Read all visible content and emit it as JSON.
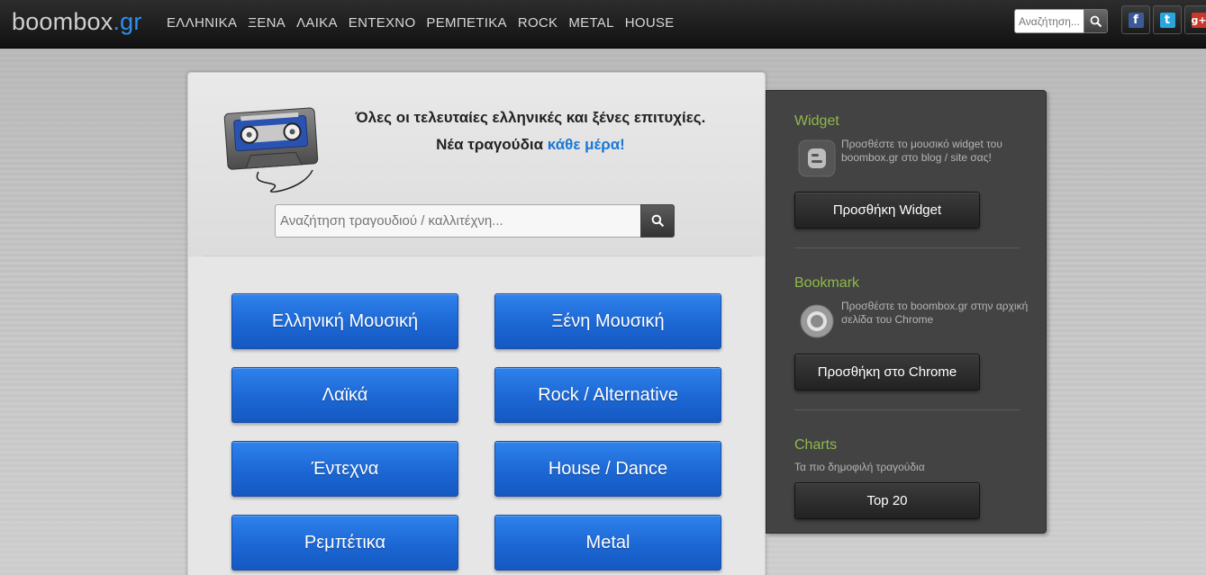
{
  "header": {
    "logo_main": "boombox",
    "logo_tld": ".gr",
    "nav": [
      "ΕΛΛΗΝΙΚΑ",
      "ΞΕΝΑ",
      "ΛΑΙΚΑ",
      "ΕΝΤΕΧΝΟ",
      "ΡΕΜΠΕΤΙΚΑ",
      "ROCK",
      "METAL",
      "HOUSE"
    ],
    "search_placeholder": "Αναζήτηση...",
    "social": {
      "facebook": "f",
      "twitter": "t",
      "google": "g+"
    }
  },
  "main": {
    "tagline_line1": "Όλες οι τελευταίες ελληνικές και ξένες επιτυχίες.",
    "tagline_line2_prefix": "Νέα τραγούδια ",
    "tagline_line2_highlight": "κάθε μέρα!",
    "search_placeholder": "Αναζήτηση τραγουδιού / καλλιτέχνη...",
    "categories": [
      "Ελληνική Μουσική",
      "Ξένη Μουσική",
      "Λαϊκά",
      "Rock / Alternative",
      "Έντεχνα",
      "House / Dance",
      "Ρεμπέτικα",
      "Metal"
    ]
  },
  "sidebar": {
    "widget": {
      "title": "Widget",
      "desc": "Προσθέστε το μουσικό widget του boombox.gr στο blog / site σας!",
      "button": "Προσθήκη Widget"
    },
    "bookmark": {
      "title": "Bookmark",
      "desc": "Προσθέστε το boombox.gr στην αρχική σελίδα του Chrome",
      "button": "Προσθήκη στο Chrome"
    },
    "charts": {
      "title": "Charts",
      "desc": "Τα πιο δημοφιλή τραγούδια",
      "button": "Top 20"
    }
  },
  "colors": {
    "accent_blue": "#1a78d6",
    "button_blue": "#1c67d4",
    "sidebar_heading": "#8fb84a",
    "topbar": "#1a1a1a"
  }
}
